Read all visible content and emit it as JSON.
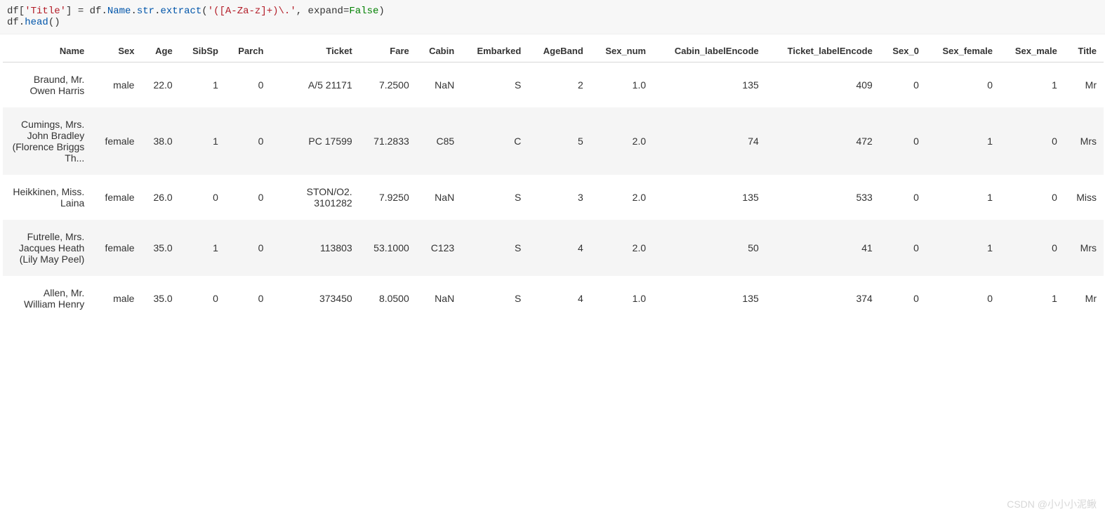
{
  "code": {
    "line1": {
      "p1": "df[",
      "str1": "'Title'",
      "p2": "] = df.",
      "attr1": "Name",
      "p3": ".",
      "attr2": "str",
      "p4": ".",
      "attr3": "extract",
      "p5": "(",
      "str2": "'([A-Za-z]+)\\.'",
      "p6": ", expand=",
      "false": "False",
      "p7": ")"
    },
    "line2": {
      "p1": "df.",
      "attr1": "head",
      "p2": "()"
    }
  },
  "table": {
    "headers": [
      "Name",
      "Sex",
      "Age",
      "SibSp",
      "Parch",
      "Ticket",
      "Fare",
      "Cabin",
      "Embarked",
      "AgeBand",
      "Sex_num",
      "Cabin_labelEncode",
      "Ticket_labelEncode",
      "Sex_0",
      "Sex_female",
      "Sex_male",
      "Title"
    ],
    "rows": [
      {
        "Name": "Braund, Mr. Owen Harris",
        "Sex": "male",
        "Age": "22.0",
        "SibSp": "1",
        "Parch": "0",
        "Ticket": "A/5 21171",
        "Fare": "7.2500",
        "Cabin": "NaN",
        "Embarked": "S",
        "AgeBand": "2",
        "Sex_num": "1.0",
        "Cabin_labelEncode": "135",
        "Ticket_labelEncode": "409",
        "Sex_0": "0",
        "Sex_female": "0",
        "Sex_male": "1",
        "Title": "Mr"
      },
      {
        "Name": "Cumings, Mrs. John Bradley (Florence Briggs Th...",
        "Sex": "female",
        "Age": "38.0",
        "SibSp": "1",
        "Parch": "0",
        "Ticket": "PC 17599",
        "Fare": "71.2833",
        "Cabin": "C85",
        "Embarked": "C",
        "AgeBand": "5",
        "Sex_num": "2.0",
        "Cabin_labelEncode": "74",
        "Ticket_labelEncode": "472",
        "Sex_0": "0",
        "Sex_female": "1",
        "Sex_male": "0",
        "Title": "Mrs"
      },
      {
        "Name": "Heikkinen, Miss. Laina",
        "Sex": "female",
        "Age": "26.0",
        "SibSp": "0",
        "Parch": "0",
        "Ticket": "STON/O2. 3101282",
        "Fare": "7.9250",
        "Cabin": "NaN",
        "Embarked": "S",
        "AgeBand": "3",
        "Sex_num": "2.0",
        "Cabin_labelEncode": "135",
        "Ticket_labelEncode": "533",
        "Sex_0": "0",
        "Sex_female": "1",
        "Sex_male": "0",
        "Title": "Miss"
      },
      {
        "Name": "Futrelle, Mrs. Jacques Heath (Lily May Peel)",
        "Sex": "female",
        "Age": "35.0",
        "SibSp": "1",
        "Parch": "0",
        "Ticket": "113803",
        "Fare": "53.1000",
        "Cabin": "C123",
        "Embarked": "S",
        "AgeBand": "4",
        "Sex_num": "2.0",
        "Cabin_labelEncode": "50",
        "Ticket_labelEncode": "41",
        "Sex_0": "0",
        "Sex_female": "1",
        "Sex_male": "0",
        "Title": "Mrs"
      },
      {
        "Name": "Allen, Mr. William Henry",
        "Sex": "male",
        "Age": "35.0",
        "SibSp": "0",
        "Parch": "0",
        "Ticket": "373450",
        "Fare": "8.0500",
        "Cabin": "NaN",
        "Embarked": "S",
        "AgeBand": "4",
        "Sex_num": "1.0",
        "Cabin_labelEncode": "135",
        "Ticket_labelEncode": "374",
        "Sex_0": "0",
        "Sex_female": "0",
        "Sex_male": "1",
        "Title": "Mr"
      }
    ]
  },
  "watermark": "CSDN @小小小泥鳅"
}
